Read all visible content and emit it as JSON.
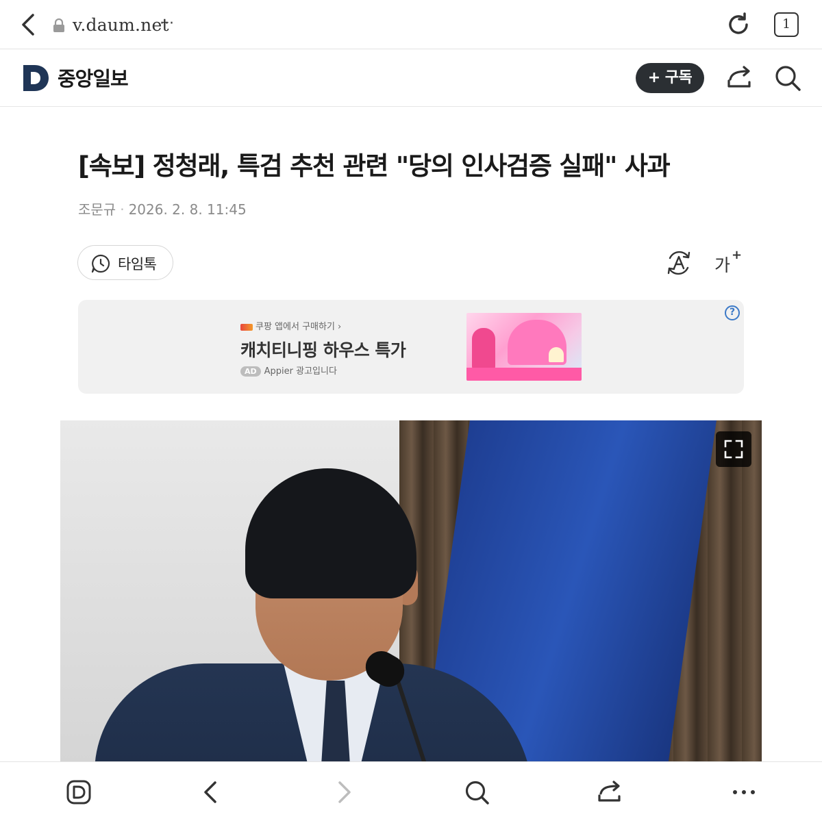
{
  "browser": {
    "url": "v.daum.net",
    "url_more": "···",
    "tab_count": "1"
  },
  "site": {
    "publisher": "중앙일보",
    "subscribe_label": "+ 구독"
  },
  "article": {
    "title": "[속보] 정청래, 특검 추천 관련 \"당의 인사검증 실패\" 사과",
    "author": "조문규",
    "separator": "·",
    "datetime": "2026. 2. 8. 11:45",
    "timetalk_label": "타임톡",
    "font_size_label": "가",
    "font_size_plus": "+"
  },
  "ad": {
    "shop_link": "쿠팡 앱에서 구매하기 ›",
    "headline": "캐치티니핑 하우스 특가",
    "badge": "AD",
    "sponsor": "Appier 광고입니다",
    "help": "?"
  },
  "icons": {
    "back": "chevron-left-icon",
    "lock": "lock-icon",
    "reload": "reload-icon",
    "share": "share-icon",
    "search": "search-icon",
    "timetalk": "chat-clock-icon",
    "translate": "translate-icon",
    "expand": "expand-icon",
    "daum_home": "daum-logo-icon",
    "forward": "chevron-right-icon",
    "more": "more-icon"
  },
  "colors": {
    "subscribe_bg": "#2b2f33",
    "logo": "#1f3556",
    "ad_bg": "#f1f1f1",
    "help_icon": "#3c79c7"
  }
}
